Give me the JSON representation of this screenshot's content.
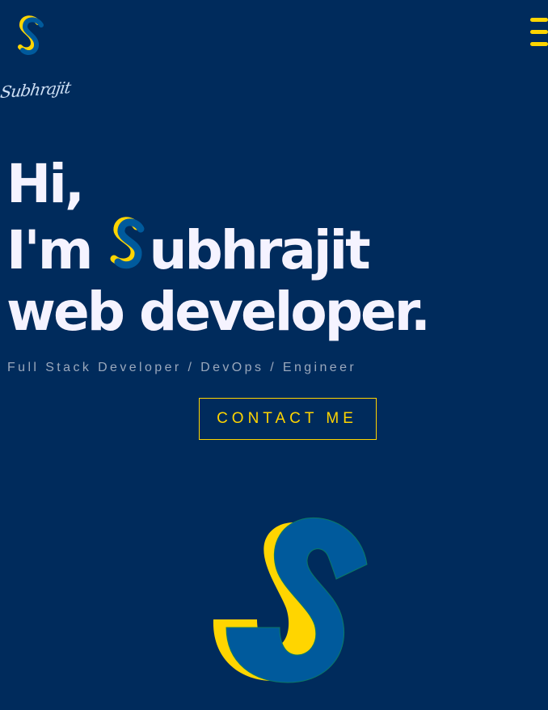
{
  "header": {
    "logo_icon": "s-logo-icon",
    "menu_icon": "hamburger-menu-icon",
    "signature": "Subhrajit"
  },
  "hero": {
    "greeting": "Hi,",
    "intro_prefix": "I'm",
    "name_rest": "ubhrajit",
    "name_initial_icon": "s-logo-icon",
    "role": "web developer.",
    "tagline": "Full Stack Developer / DevOps / Engineer",
    "cta_label": "CONTACT ME"
  },
  "colors": {
    "background": "#002b5c",
    "accent_yellow": "#ffd500",
    "logo_blue": "#005a9c",
    "heading_text": "#f5f3ff",
    "tagline_text": "#9aa8bc"
  }
}
